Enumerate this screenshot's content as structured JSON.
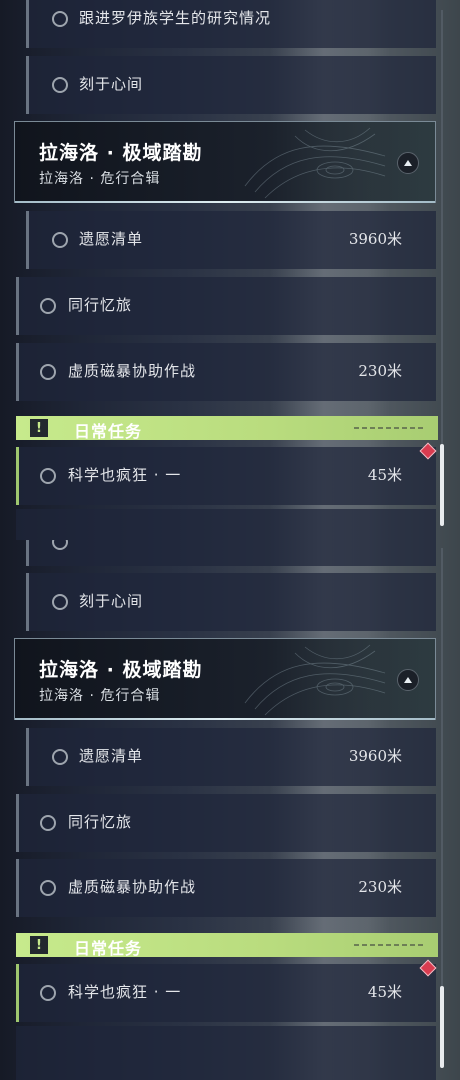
{
  "panels": [
    {
      "top_items": [
        {
          "label": "跟进罗伊族学生的研究情况"
        },
        {
          "label": "刻于心间"
        }
      ],
      "chapter": {
        "title": "拉海洛 · 极域踏勘",
        "subtitle": "拉海洛 · 危行合辑",
        "toggle_icon": "chevron-up-icon"
      },
      "chapter_items": [
        {
          "label": "遗愿清单",
          "distance": "3960米"
        }
      ],
      "side_items": [
        {
          "label": "同行忆旅",
          "distance": ""
        },
        {
          "label": "虚质磁暴协助作战",
          "distance": "230米"
        }
      ],
      "daily": {
        "label": "日常任务",
        "icon": "exclamation-icon"
      },
      "daily_items": [
        {
          "label": "科学也疯狂 · 一",
          "distance": "45米"
        }
      ]
    },
    {
      "top_items": [
        {
          "label": "刻于心间"
        }
      ],
      "chapter": {
        "title": "拉海洛 · 极域踏勘",
        "subtitle": "拉海洛 · 危行合辑",
        "toggle_icon": "chevron-up-icon"
      },
      "chapter_items": [
        {
          "label": "遗愿清单",
          "distance": "3960米"
        }
      ],
      "side_items": [
        {
          "label": "同行忆旅",
          "distance": ""
        },
        {
          "label": "虚质磁暴协助作战",
          "distance": "230米"
        }
      ],
      "daily": {
        "label": "日常任务",
        "icon": "exclamation-icon"
      },
      "daily_items": [
        {
          "label": "科学也疯狂 · 一",
          "distance": "45米"
        }
      ]
    }
  ],
  "colors": {
    "daily_accent": "#c7ea8c",
    "marker": "#d93c50",
    "scroll_thumb": "#e9ecef"
  }
}
